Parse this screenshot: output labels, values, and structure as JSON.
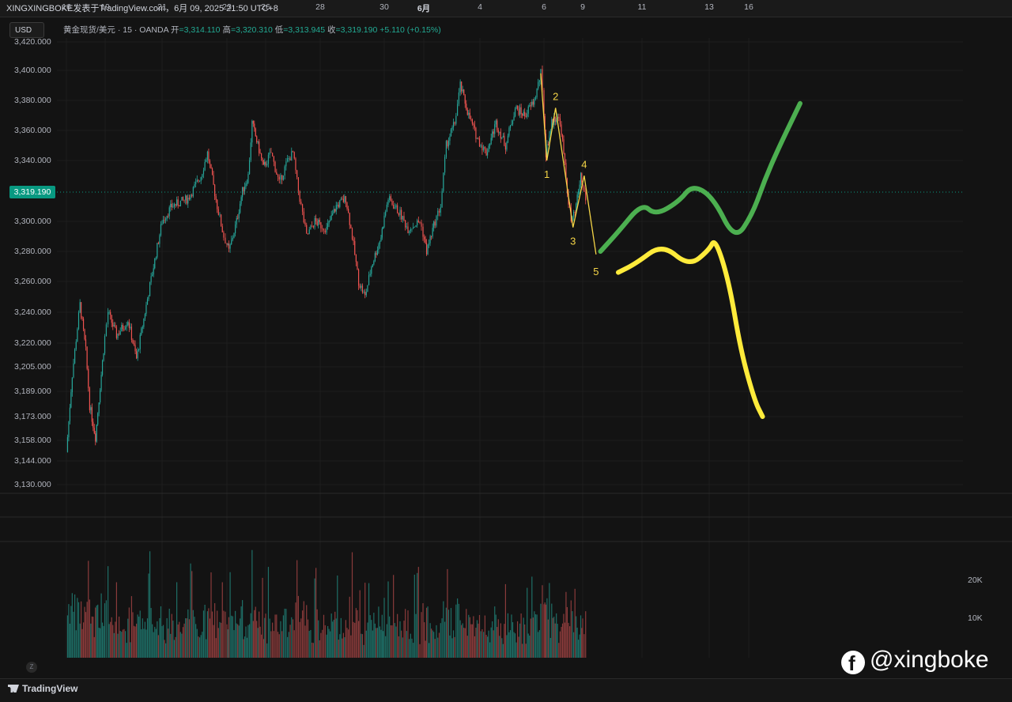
{
  "header": {
    "title": "XINGXINGBOKE发表于TradingView.com，6月 09, 2025 21:50 UTC+8"
  },
  "currency_button": "USD",
  "legend": {
    "symbol": "黄金现货/美元 · 15 · OANDA",
    "open_label": "开",
    "open": "=3,314.110",
    "high_label": "高",
    "high": "=3,320.310",
    "low_label": "低",
    "low": "=3,313.945",
    "close_label": "收",
    "close": "=3,319.190",
    "change": "+5.110 (+0.15%)"
  },
  "current_price": "3,319.190",
  "colors": {
    "background": "#131313",
    "up": "#26a69a",
    "down": "#ef5350",
    "current_price": "#089981",
    "wave": "#f5d547",
    "scenario_green": "#4caf50",
    "scenario_yellow": "#ffeb3b"
  },
  "chart_data": {
    "type": "line",
    "title": "黄金现货/美元 · 15 · OANDA",
    "y_axis": {
      "ticks": [
        "3,420.000",
        "3,400.000",
        "3,380.000",
        "3,360.000",
        "3,340.000",
        "3,300.000",
        "3,280.000",
        "3,260.000",
        "3,240.000",
        "3,220.000",
        "3,205.000",
        "3,189.000",
        "3,173.000",
        "3,158.000",
        "3,144.000",
        "3,130.000"
      ],
      "tick_values": [
        3420,
        3400,
        3380,
        3360,
        3340,
        3300,
        3280,
        3260,
        3240,
        3220,
        3205,
        3189,
        3173,
        3158,
        3144,
        3130
      ],
      "scale": "log"
    },
    "x_axis": {
      "ticks": [
        "16",
        "19",
        "21",
        "23",
        "26",
        "28",
        "30",
        "6月",
        "4",
        "6",
        "9",
        "11",
        "13",
        "16"
      ],
      "tick_positions_day": [
        0,
        2,
        4,
        6,
        8,
        10,
        12,
        13,
        15,
        17,
        19,
        21,
        23,
        25
      ]
    },
    "price_path": [
      [
        0,
        3150
      ],
      [
        0.3,
        3200
      ],
      [
        0.7,
        3245
      ],
      [
        1.0,
        3215
      ],
      [
        1.2,
        3180
      ],
      [
        1.5,
        3160
      ],
      [
        1.8,
        3200
      ],
      [
        2.1,
        3240
      ],
      [
        2.4,
        3225
      ],
      [
        2.8,
        3235
      ],
      [
        3.1,
        3210
      ],
      [
        3.4,
        3240
      ],
      [
        3.7,
        3270
      ],
      [
        4.0,
        3300
      ],
      [
        4.3,
        3310
      ],
      [
        4.8,
        3315
      ],
      [
        5.2,
        3330
      ],
      [
        5.4,
        3345
      ],
      [
        5.7,
        3310
      ],
      [
        5.9,
        3290
      ],
      [
        6.1,
        3280
      ],
      [
        6.5,
        3300
      ],
      [
        6.8,
        3320
      ],
      [
        7.1,
        3330
      ],
      [
        7.3,
        3365
      ],
      [
        7.6,
        3350
      ],
      [
        7.9,
        3335
      ],
      [
        8.2,
        3345
      ],
      [
        8.5,
        3325
      ],
      [
        8.8,
        3340
      ],
      [
        9.0,
        3345
      ],
      [
        9.2,
        3320
      ],
      [
        9.5,
        3290
      ],
      [
        9.8,
        3300
      ],
      [
        10.2,
        3295
      ],
      [
        10.5,
        3310
      ],
      [
        10.8,
        3315
      ],
      [
        11.0,
        3290
      ],
      [
        11.2,
        3260
      ],
      [
        11.4,
        3250
      ],
      [
        11.6,
        3270
      ],
      [
        11.9,
        3290
      ],
      [
        12.1,
        3315
      ],
      [
        12.4,
        3305
      ],
      [
        12.6,
        3295
      ],
      [
        12.9,
        3300
      ],
      [
        13.1,
        3280
      ],
      [
        13.4,
        3300
      ],
      [
        13.6,
        3310
      ],
      [
        13.8,
        3350
      ],
      [
        14.1,
        3365
      ],
      [
        14.3,
        3390
      ],
      [
        14.6,
        3370
      ],
      [
        14.9,
        3355
      ],
      [
        15.2,
        3345
      ],
      [
        15.5,
        3365
      ],
      [
        15.8,
        3350
      ],
      [
        16.1,
        3375
      ],
      [
        16.4,
        3370
      ],
      [
        16.7,
        3380
      ],
      [
        16.9,
        3398
      ],
      [
        17.1,
        3345
      ],
      [
        17.4,
        3365
      ],
      [
        17.7,
        3370
      ],
      [
        17.9,
        3360
      ],
      [
        18.2,
        3320
      ],
      [
        18.4,
        3300
      ],
      [
        18.6,
        3305
      ],
      [
        18.9,
        3330
      ],
      [
        19.1,
        3315
      ]
    ],
    "elliott_wave": {
      "labels": [
        "1",
        "2",
        "3",
        "4",
        "5"
      ],
      "points": [
        [
          17.15,
          3340
        ],
        [
          17.6,
          3375
        ],
        [
          18.5,
          3296
        ],
        [
          19.05,
          3330
        ],
        [
          19.45,
          3278
        ]
      ]
    },
    "scenarios": [
      {
        "color": "green",
        "path": [
          [
            19.6,
            3280
          ],
          [
            20.2,
            3293
          ],
          [
            21.0,
            3312
          ],
          [
            21.4,
            3304
          ],
          [
            22.1,
            3313
          ],
          [
            22.5,
            3324
          ],
          [
            23.2,
            3316
          ],
          [
            24.3,
            3287
          ],
          [
            25.2,
            3305
          ],
          [
            25.8,
            3327
          ],
          [
            26.5,
            3348
          ],
          [
            27.6,
            3378
          ]
        ]
      },
      {
        "color": "yellow",
        "path": [
          [
            20.2,
            3266
          ],
          [
            20.8,
            3272
          ],
          [
            21.6,
            3285
          ],
          [
            22.4,
            3270
          ],
          [
            23.0,
            3281
          ],
          [
            23.3,
            3289
          ],
          [
            24.0,
            3260
          ],
          [
            24.6,
            3215
          ],
          [
            25.3,
            3183
          ],
          [
            25.7,
            3173
          ]
        ]
      }
    ],
    "volume": {
      "ticks": [
        "20K",
        "10K"
      ],
      "tick_values": [
        20000,
        10000
      ]
    },
    "grid": true
  },
  "footer": {
    "brand": "TradingView"
  },
  "watermark": "@xingboke"
}
